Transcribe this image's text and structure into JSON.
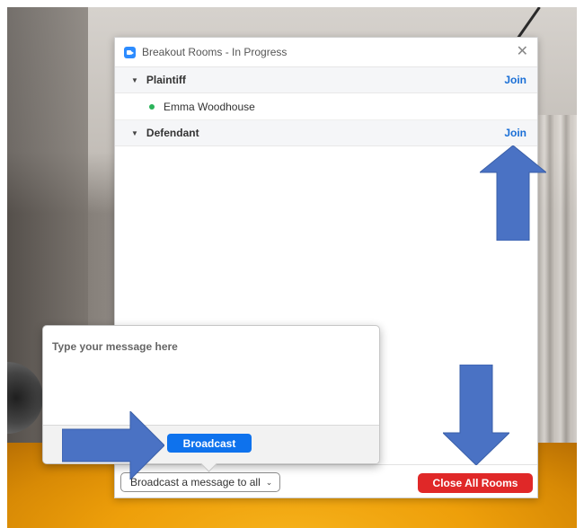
{
  "window": {
    "title": "Breakout Rooms - In Progress",
    "close_glyph": "✕"
  },
  "rooms": [
    {
      "caret": "▼",
      "name": "Plaintiff",
      "join_label": "Join",
      "participants": [
        {
          "name": "Emma Woodhouse",
          "status_color": "#2bb35a"
        }
      ]
    },
    {
      "caret": "▼",
      "name": "Defendant",
      "join_label": "Join",
      "participants": []
    }
  ],
  "broadcast_popup": {
    "placeholder": "Type your message here",
    "button_label": "Broadcast"
  },
  "footer": {
    "broadcast_dropdown_label": "Broadcast a message to all",
    "dropdown_chevron": "⌄",
    "close_all_label": "Close All Rooms"
  },
  "colors": {
    "accent_blue": "#0e72ed",
    "join_link": "#1a6fd6",
    "danger_red": "#e02828",
    "annotation_arrow": "#4a72c4"
  },
  "icons": {
    "app": "zoom-camera-icon",
    "close": "close-icon",
    "caret": "caret-down-icon",
    "dropdown": "chevron-down-icon"
  }
}
